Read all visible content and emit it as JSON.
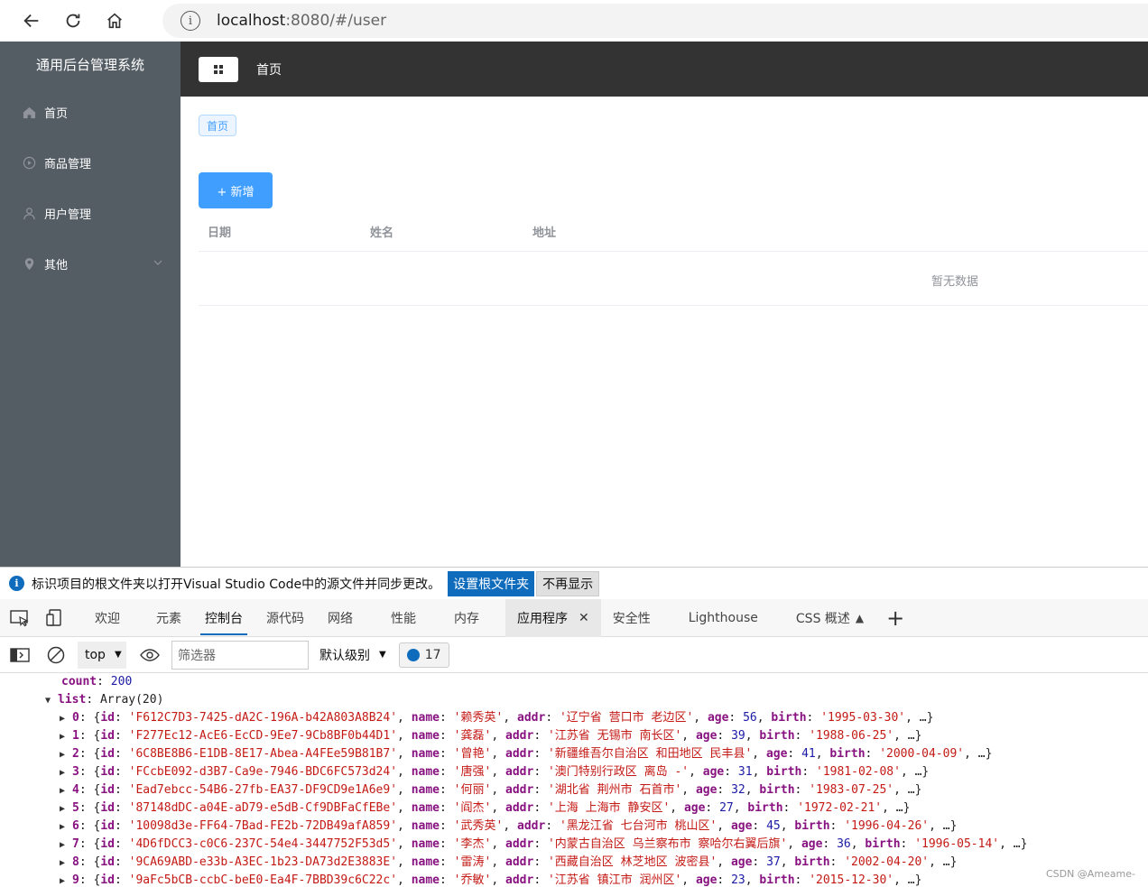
{
  "browser": {
    "url_host": "localhost",
    "url_rest": ":8080/#/user"
  },
  "sidebar": {
    "title": "通用后台管理系统",
    "items": [
      {
        "label": "首页",
        "icon": "home-icon"
      },
      {
        "label": "商品管理",
        "icon": "play-circle-icon"
      },
      {
        "label": "用户管理",
        "icon": "user-icon"
      },
      {
        "label": "其他",
        "icon": "location-icon"
      }
    ]
  },
  "header": {
    "title": "首页"
  },
  "main": {
    "tag": "首页",
    "add_button": "+ 新增",
    "columns": [
      "日期",
      "姓名",
      "地址"
    ],
    "empty_text": "暂无数据"
  },
  "notice": {
    "message": "标识项目的根文件夹以打开Visual Studio Code中的源文件并同步更改。",
    "primary": "设置根文件夹",
    "secondary": "不再显示"
  },
  "devtools": {
    "tabs": [
      "欢迎",
      "元素",
      "控制台",
      "源代码",
      "网络",
      "性能",
      "内存",
      "应用程序",
      "安全性",
      "Lighthouse",
      "CSS 概述"
    ],
    "active_tab": "控制台",
    "selected_tab": "应用程序"
  },
  "console_bar": {
    "context": "top",
    "filter_placeholder": "筛选器",
    "level": "默认级别",
    "message_count": "17"
  },
  "console": {
    "count_key": "count",
    "count_value": "200",
    "list_key": "list",
    "list_type": "Array(20)",
    "rows": [
      {
        "index": "0",
        "id": "F612C7D3-7425-dA2C-196A-b42A803A8B24",
        "name": "赖秀英",
        "addr": "辽宁省 营口市 老边区",
        "age": "56",
        "birth": "1995-03-30"
      },
      {
        "index": "1",
        "id": "F277Ec12-AcE6-EcCD-9Ee7-9Cb8BF0b44D1",
        "name": "龚磊",
        "addr": "江苏省 无锡市 南长区",
        "age": "39",
        "birth": "1988-06-25"
      },
      {
        "index": "2",
        "id": "6C8BE8B6-E1DB-8E17-Abea-A4FEe59B81B7",
        "name": "曾艳",
        "addr": "新疆维吾尔自治区 和田地区 民丰县",
        "age": "41",
        "birth": "2000-04-09"
      },
      {
        "index": "3",
        "id": "FCcbE092-d3B7-Ca9e-7946-BDC6FC573d24",
        "name": "唐强",
        "addr": "澳门特别行政区 离岛 -",
        "age": "31",
        "birth": "1981-02-08"
      },
      {
        "index": "4",
        "id": "Ead7ebcc-54B6-27fb-EA37-DF9CD9e1A6e9",
        "name": "何丽",
        "addr": "湖北省 荆州市 石首市",
        "age": "32",
        "birth": "1983-07-25"
      },
      {
        "index": "5",
        "id": "87148dDC-a04E-aD79-e5dB-Cf9DBFaCfEBe",
        "name": "阎杰",
        "addr": "上海 上海市 静安区",
        "age": "27",
        "birth": "1972-02-21"
      },
      {
        "index": "6",
        "id": "10098d3e-FF64-7Bad-FE2b-72DB49afA859",
        "name": "武秀英",
        "addr": "黑龙江省 七台河市 桃山区",
        "age": "45",
        "birth": "1996-04-26"
      },
      {
        "index": "7",
        "id": "4D6fDCC3-c0C6-237C-54e4-3447752F53d5",
        "name": "李杰",
        "addr": "内蒙古自治区 乌兰察布市 察哈尔右翼后旗",
        "age": "36",
        "birth": "1996-05-14"
      },
      {
        "index": "8",
        "id": "9CA69ABD-e33b-A3EC-1b23-DA73d2E3883E",
        "name": "雷涛",
        "addr": "西藏自治区 林芝地区 波密县",
        "age": "37",
        "birth": "2002-04-20"
      },
      {
        "index": "9",
        "id": "9aFc5bCB-ccbC-beE0-Ea4F-7BBD39c6C22c",
        "name": "乔敏",
        "addr": "江苏省 镇江市 润州区",
        "age": "23",
        "birth": "2015-12-30"
      }
    ]
  },
  "watermark": "CSDN @Ameame-"
}
